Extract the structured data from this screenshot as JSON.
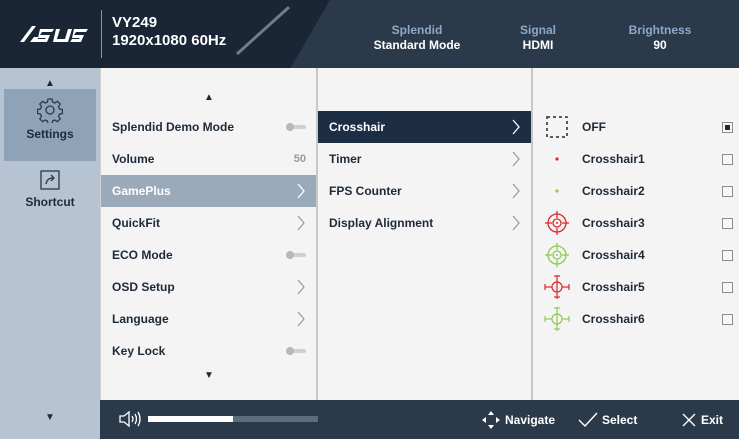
{
  "header": {
    "brand": "ASUS",
    "model": "VY249",
    "resolution": "1920x1080 60Hz",
    "status": [
      {
        "label": "Splendid",
        "value": "Standard Mode"
      },
      {
        "label": "Signal",
        "value": "HDMI"
      },
      {
        "label": "Brightness",
        "value": "90"
      }
    ]
  },
  "rail": {
    "items": [
      {
        "label": "Settings",
        "icon": "gear-icon",
        "active": true
      },
      {
        "label": "Shortcut",
        "icon": "shortcut-arrow-icon",
        "active": false
      }
    ]
  },
  "menu": {
    "items": [
      {
        "label": "Splendid Demo Mode",
        "control": "toggle"
      },
      {
        "label": "Volume",
        "value": "50"
      },
      {
        "label": "GamePlus",
        "control": "chevron",
        "selected": true
      },
      {
        "label": "QuickFit",
        "control": "chevron"
      },
      {
        "label": "ECO Mode",
        "control": "toggle"
      },
      {
        "label": "OSD Setup",
        "control": "chevron"
      },
      {
        "label": "Language",
        "control": "chevron"
      },
      {
        "label": "Key Lock",
        "control": "toggle"
      }
    ]
  },
  "submenu": {
    "items": [
      {
        "label": "Crosshair",
        "selected": true
      },
      {
        "label": "Timer"
      },
      {
        "label": "FPS Counter"
      },
      {
        "label": "Display Alignment"
      }
    ]
  },
  "crosshairs": {
    "items": [
      {
        "label": "OFF",
        "icon": "crosshair-off-icon",
        "checked": true
      },
      {
        "label": "Crosshair1",
        "icon": "red-dot-icon",
        "checked": false
      },
      {
        "label": "Crosshair2",
        "icon": "green-dot-icon",
        "checked": false
      },
      {
        "label": "Crosshair3",
        "icon": "red-target-icon",
        "checked": false
      },
      {
        "label": "Crosshair4",
        "icon": "green-target-icon",
        "checked": false
      },
      {
        "label": "Crosshair5",
        "icon": "red-scope-icon",
        "checked": false
      },
      {
        "label": "Crosshair6",
        "icon": "green-scope-icon",
        "checked": false
      }
    ]
  },
  "footer": {
    "volume_level": 0.5,
    "navigate_label": "Navigate",
    "select_label": "Select",
    "exit_label": "Exit"
  },
  "colors": {
    "header_bg": "#2b3a4b",
    "rail_bg": "#b5c3d2",
    "selected_row": "#9aaabb",
    "selected_dark": "#1d2d44",
    "red": "#e0262b",
    "green": "#8ecb52"
  }
}
